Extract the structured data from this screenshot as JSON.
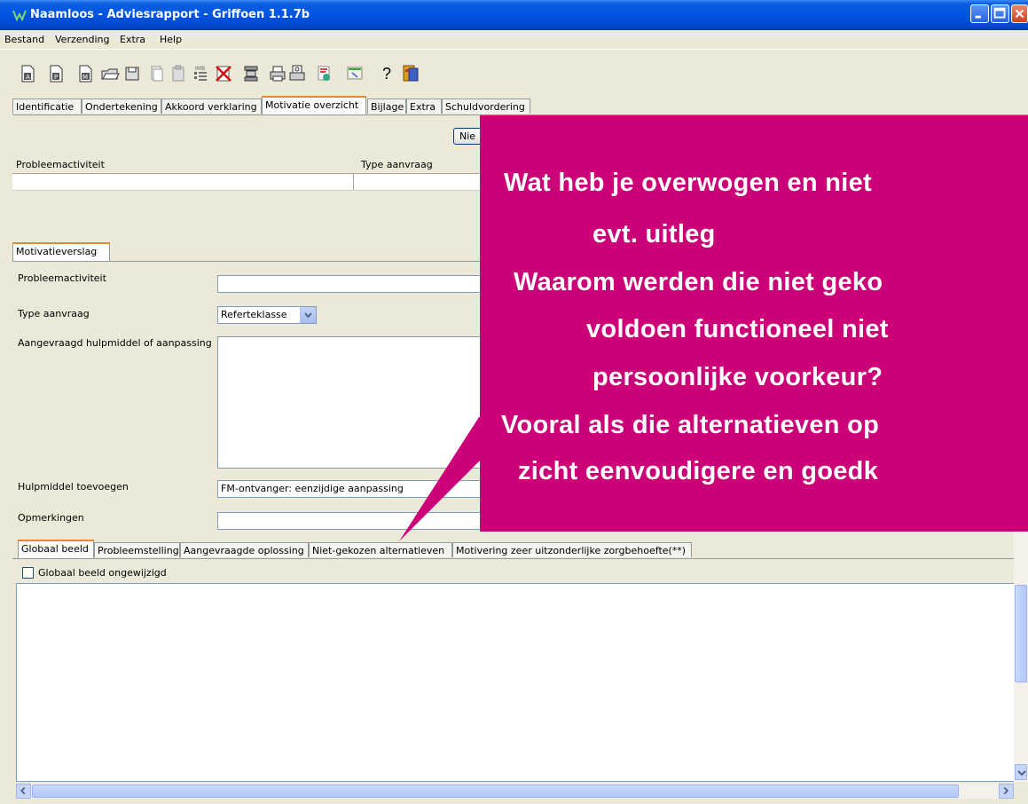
{
  "window": {
    "title": "Naamloos - Adviesrapport - Griffoen 1.1.7b",
    "titlebar_color": "#0054e3"
  },
  "menu": [
    "Bestand",
    "Verzending",
    "Extra",
    "Help"
  ],
  "toolbar": {
    "icons": [
      "document-a-icon",
      "document-p-icon",
      "document-m-icon",
      "open-folder-icon",
      "save-icon",
      "copy-doc-icon",
      "paste-doc-icon",
      "imb-icon",
      "delete-icon",
      "database-icon",
      "print-icon",
      "print-preview-icon",
      "send-icon",
      "export-icon",
      "help-icon",
      "exit-icon"
    ],
    "help_label": "?"
  },
  "top_tabs": [
    "Identificatie",
    "Ondertekening",
    "Akkoord verklaring",
    "Motivatie overzicht",
    "Bijlage",
    "Extra",
    "Schuldvordering"
  ],
  "top_tabs_active": "Motivatie overzicht",
  "nieuw_button_partial": "Nie",
  "overview_grid": {
    "columns": [
      "Probleemactiviteit",
      "Type aanvraag"
    ]
  },
  "sub_tab": "Motivatieverslag",
  "form": {
    "probleemactiviteit_label": "Probleemactiviteit",
    "probleemactiviteit_value": "",
    "type_aanvraag_label": "Type aanvraag",
    "type_aanvraag_value": "Referteklasse",
    "aangevraagd_label": "Aangevraagd hulpmiddel of aanpassing",
    "aangevraagd_value": "",
    "hulpmiddel_label": "Hulpmiddel toevoegen",
    "hulpmiddel_value": "FM-ontvanger: eenzijdige aanpassing",
    "opmerkingen_label": "Opmerkingen",
    "opmerkingen_value": ""
  },
  "bottom_tabs": [
    "Globaal beeld",
    "Probleemstelling",
    "Aangevraagde oplossing",
    "Niet-gekozen alternatieven",
    "Motivering zeer uitzonderlijke zorgbehoefte(**)"
  ],
  "bottom_tabs_active": "Globaal beeld",
  "checkbox": {
    "label": "Globaal beeld ongewijzigd",
    "checked": false
  },
  "callout": {
    "color": "#cc0077",
    "lines": [
      "Wat heb je overwogen en niet",
      "evt. uitleg",
      "Waarom werden die niet geko",
      "voldoen functioneel niet",
      "persoonlijke voorkeur?",
      "Vooral als die alternatieven op",
      "zicht eenvoudigere en goedk"
    ]
  }
}
